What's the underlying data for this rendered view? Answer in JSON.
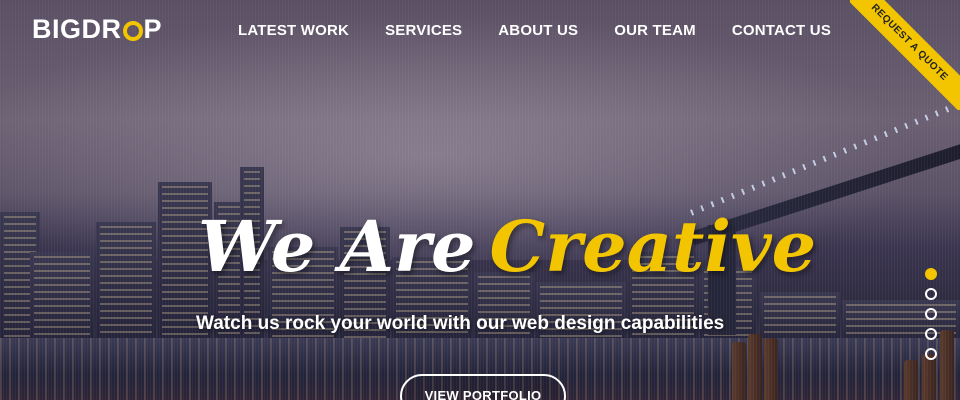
{
  "brand": {
    "logo_prefix": "BIGDR",
    "logo_suffix": "P",
    "accent_color": "#f2c500"
  },
  "nav": {
    "items": [
      {
        "label": "LATEST WORK"
      },
      {
        "label": "SERVICES"
      },
      {
        "label": "ABOUT US"
      },
      {
        "label": "OUR TEAM"
      },
      {
        "label": "CONTACT US"
      }
    ]
  },
  "ribbon": {
    "label": "REQUEST A QUOTE"
  },
  "hero": {
    "headline_part1": "We Are",
    "headline_part2": "Creative",
    "subheadline": "Watch us rock your world with our web design capabilities",
    "cta_label": "VIEW PORTFOLIO"
  },
  "slider": {
    "total_slides": 5,
    "active_index": 0
  }
}
